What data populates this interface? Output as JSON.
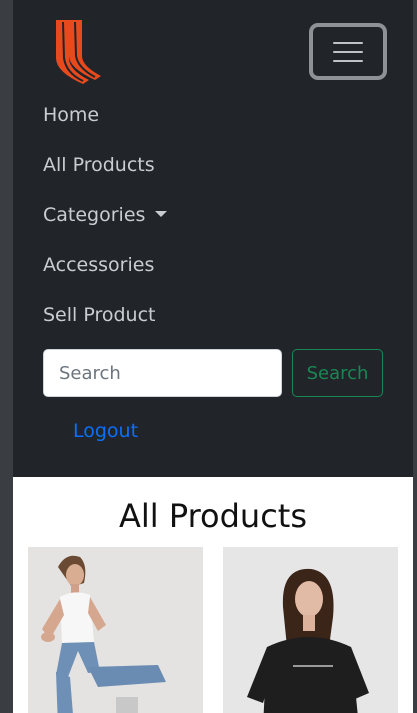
{
  "brand": {
    "logo_icon": "brand-logo-icon",
    "color": "#e8491d"
  },
  "navbar": {
    "toggle_icon": "hamburger-icon",
    "links": [
      {
        "label": "Home"
      },
      {
        "label": "All Products"
      },
      {
        "label": "Categories",
        "has_dropdown": true
      },
      {
        "label": "Accessories"
      },
      {
        "label": "Sell Product"
      }
    ],
    "search": {
      "placeholder": "Search",
      "value": "",
      "button_label": "Search"
    },
    "logout_label": "Logout"
  },
  "main": {
    "title": "All Products",
    "products": [
      {
        "image": "model-white-top-jeans-photo"
      },
      {
        "image": "model-black-tshirt-photo"
      }
    ]
  },
  "colors": {
    "navbar_bg": "#212529",
    "link": "#0d6efd",
    "success": "#198754"
  }
}
